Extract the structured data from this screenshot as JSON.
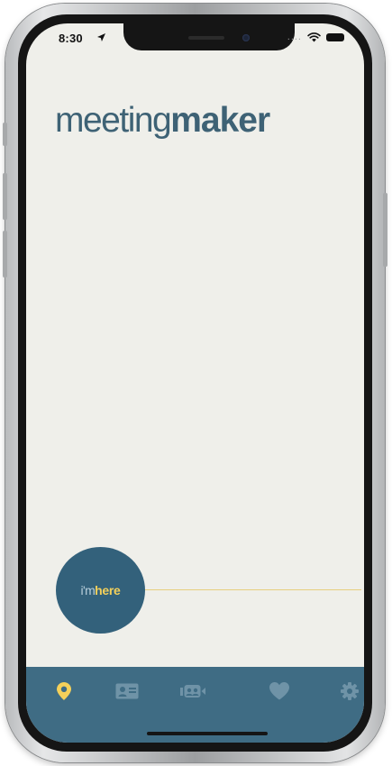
{
  "status_bar": {
    "time": "8:30",
    "signal_dots": "....",
    "icons": [
      "location-arrow-icon",
      "wifi-icon",
      "battery-icon"
    ]
  },
  "logo": {
    "light": "meeting",
    "bold": "maker"
  },
  "checkin": {
    "prefix": "i'm",
    "emphasis": "here"
  },
  "tab_bar": {
    "tabs": [
      {
        "icon": "location-pin-icon",
        "active": true
      },
      {
        "icon": "contact-card-icon",
        "active": false
      },
      {
        "icon": "video-meeting-icon",
        "active": false
      },
      {
        "icon": "heart-icon",
        "active": false
      },
      {
        "icon": "gear-icon",
        "active": false
      }
    ]
  },
  "colors": {
    "screen_background": "#efefea",
    "brand_blue": "#3e6275",
    "circle_blue": "#33617b",
    "tab_bar": "#3f6c84",
    "accent_yellow": "#f4d05a",
    "inactive_icon": "#6f93a7"
  }
}
